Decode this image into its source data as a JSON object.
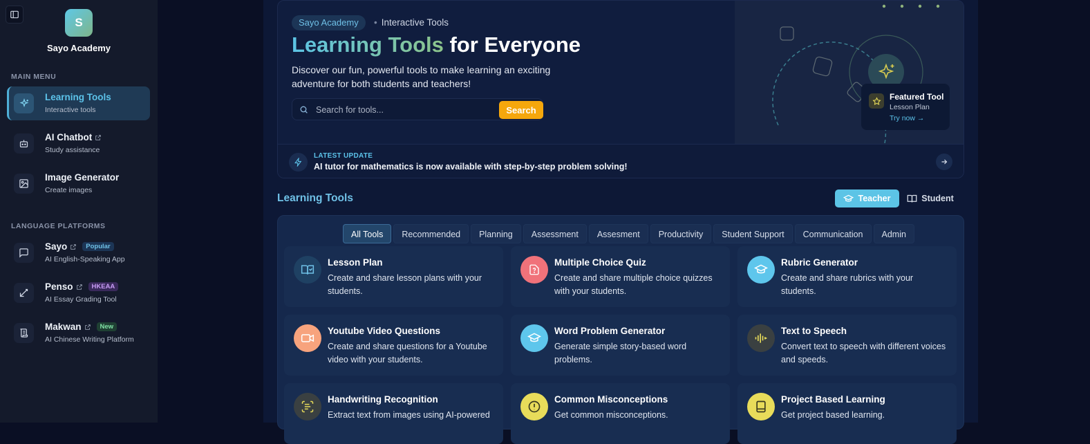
{
  "sidebar": {
    "brand_initial": "S",
    "brand_name": "Sayo Academy",
    "main_menu_label": "MAIN MENU",
    "main_items": [
      {
        "title": "Learning Tools",
        "subtitle": "Interactive tools",
        "icon": "sparkles-icon"
      },
      {
        "title": "AI Chatbot",
        "subtitle": "Study assistance",
        "icon": "robot-icon"
      },
      {
        "title": "Image Generator",
        "subtitle": "Create images",
        "icon": "image-icon"
      }
    ],
    "language_label": "LANGUAGE PLATFORMS",
    "language_items": [
      {
        "title": "Sayo",
        "badge": "Popular",
        "subtitle": "AI English-Speaking App",
        "icon": "chat-icon"
      },
      {
        "title": "Penso",
        "badge": "HKEAA",
        "subtitle": "AI Essay Grading Tool",
        "icon": "pen-icon"
      },
      {
        "title": "Makwan",
        "badge": "New",
        "subtitle": "AI Chinese Writing Platform",
        "icon": "scroll-icon"
      }
    ]
  },
  "hero": {
    "pill": "Sayo Academy",
    "pill_after": "Interactive Tools",
    "title_highlight": "Learning Tools",
    "title_rest": "for Everyone",
    "description": "Discover our fun, powerful tools to make learning an exciting adventure for both students and teachers!",
    "search_placeholder": "Search for tools...",
    "search_button": "Search",
    "featured": {
      "title": "Featured Tool",
      "subtitle": "Lesson Plan",
      "link": "Try now →"
    },
    "update_label": "LATEST UPDATE",
    "update_text": "AI tutor for mathematics is now available with step-by-step problem solving!"
  },
  "tools_section": {
    "title": "Learning Tools",
    "role_teacher": "Teacher",
    "role_student": "Student",
    "tabs": [
      "All Tools",
      "Recommended",
      "Planning",
      "Assessment",
      "Assesment",
      "Productivity",
      "Student Support",
      "Communication",
      "Admin"
    ],
    "cards": [
      {
        "title": "Lesson Plan",
        "desc": "Create and share lesson plans with your students.",
        "icon": "book-check-icon",
        "color": "#1f4163"
      },
      {
        "title": "Multiple Choice Quiz",
        "desc": "Create and share multiple choice quizzes with your students.",
        "icon": "quiz-icon",
        "color": "#f0727a"
      },
      {
        "title": "Rubric Generator",
        "desc": "Create and share rubrics with your students.",
        "icon": "graduation-cap-icon",
        "color": "#5ec6ec"
      },
      {
        "title": "Youtube Video Questions",
        "desc": "Create and share questions for a Youtube video with your students.",
        "icon": "video-icon",
        "color": "#f7a37d"
      },
      {
        "title": "Word Problem Generator",
        "desc": "Generate simple story-based word problems.",
        "icon": "graduation-cap-icon",
        "color": "#5ec6ec"
      },
      {
        "title": "Text to Speech",
        "desc": "Convert text to speech with different voices and speeds.",
        "icon": "audio-wave-icon",
        "color": "#3a4041"
      },
      {
        "title": "Handwriting Recognition",
        "desc": "Extract text from images using AI-powered",
        "icon": "scan-text-icon",
        "color": "#3a4041"
      },
      {
        "title": "Common Misconceptions",
        "desc": "Get common misconceptions.",
        "icon": "alert-circle-icon",
        "color": "#e8dc5a"
      },
      {
        "title": "Project Based Learning",
        "desc": "Get project based learning.",
        "icon": "tablet-icon",
        "color": "#e8dc5a"
      }
    ]
  }
}
